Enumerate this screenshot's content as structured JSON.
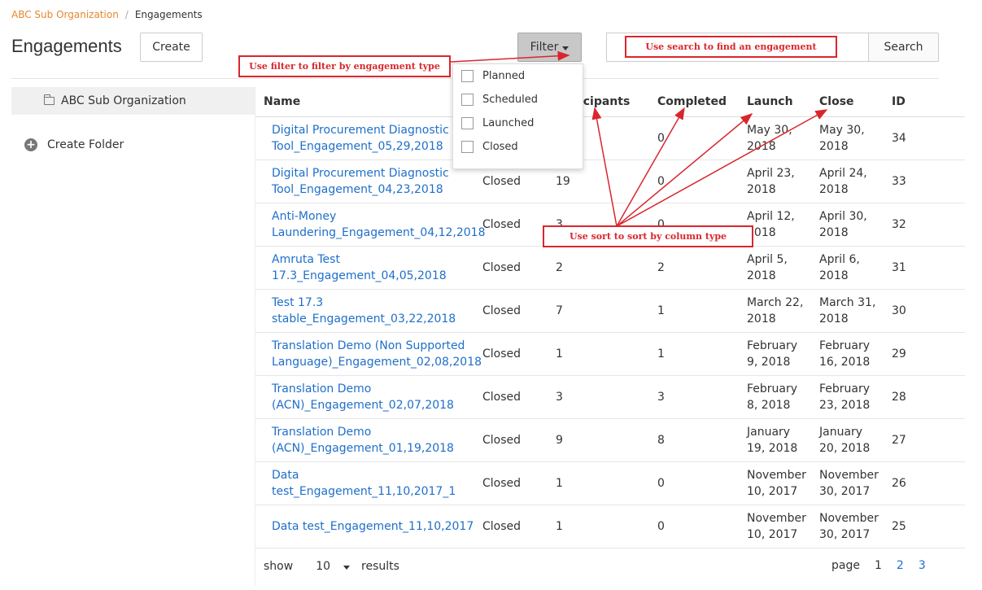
{
  "breadcrumb": {
    "org": "ABC Sub Organization",
    "separator": "/",
    "current": "Engagements"
  },
  "page_title": "Engagements",
  "toolbar": {
    "create_label": "Create",
    "filter_label": "Filter",
    "search_button": "Search",
    "search_value": ""
  },
  "filter_menu": {
    "options": [
      "Planned",
      "Scheduled",
      "Launched",
      "Closed"
    ]
  },
  "sidebar": {
    "folder": "ABC Sub Organization",
    "create_folder": "Create Folder"
  },
  "table": {
    "headers": {
      "name": "Name",
      "participants": "Participants",
      "completed": "Completed",
      "launch": "Launch",
      "close": "Close",
      "id": "ID"
    },
    "rows": [
      {
        "name": [
          "Digital Procurement Diagnostic",
          "Tool_Engagement_05,29,2018"
        ],
        "status": "",
        "participants": "",
        "completed": "0",
        "launch": [
          "May 30,",
          "2018"
        ],
        "close": [
          "May 30,",
          "2018"
        ],
        "id": "34"
      },
      {
        "name": [
          "Digital Procurement Diagnostic",
          "Tool_Engagement_04,23,2018"
        ],
        "status": "Closed",
        "participants": "19",
        "completed": "0",
        "launch": [
          "April 23,",
          "2018"
        ],
        "close": [
          "April 24,",
          "2018"
        ],
        "id": "33"
      },
      {
        "name": [
          "Anti-Money",
          "Laundering_Engagement_04,12,2018"
        ],
        "status": "Closed",
        "participants": "3",
        "completed": "0",
        "launch": [
          "April 12,",
          "2018"
        ],
        "close": [
          "April 30,",
          "2018"
        ],
        "id": "32"
      },
      {
        "name": [
          "Amruta Test",
          "17.3_Engagement_04,05,2018"
        ],
        "status": "Closed",
        "participants": "2",
        "completed": "2",
        "launch": [
          "April 5,",
          "2018"
        ],
        "close": [
          "April 6,",
          "2018"
        ],
        "id": "31"
      },
      {
        "name": [
          "Test 17.3",
          "stable_Engagement_03,22,2018"
        ],
        "status": "Closed",
        "participants": "7",
        "completed": "1",
        "launch": [
          "March 22,",
          "2018"
        ],
        "close": [
          "March 31,",
          "2018"
        ],
        "id": "30"
      },
      {
        "name": [
          "Translation Demo (Non Supported",
          "Language)_Engagement_02,08,2018"
        ],
        "status": "Closed",
        "participants": "1",
        "completed": "1",
        "launch": [
          "February",
          "9, 2018"
        ],
        "close": [
          "February",
          "16, 2018"
        ],
        "id": "29"
      },
      {
        "name": [
          "Translation Demo",
          "(ACN)_Engagement_02,07,2018"
        ],
        "status": "Closed",
        "participants": "3",
        "completed": "3",
        "launch": [
          "February",
          "8, 2018"
        ],
        "close": [
          "February",
          "23, 2018"
        ],
        "id": "28"
      },
      {
        "name": [
          "Translation Demo",
          "(ACN)_Engagement_01,19,2018"
        ],
        "status": "Closed",
        "participants": "9",
        "completed": "8",
        "launch": [
          "January",
          "19, 2018"
        ],
        "close": [
          "January",
          "20, 2018"
        ],
        "id": "27"
      },
      {
        "name": [
          "Data test_Engagement_11,10,2017_1",
          ""
        ],
        "status": "Closed",
        "participants": "1",
        "completed": "0",
        "launch": [
          "November",
          "10, 2017"
        ],
        "close": [
          "November",
          "30, 2017"
        ],
        "id": "26"
      },
      {
        "name": [
          "Data test_Engagement_11,10,2017",
          ""
        ],
        "status": "Closed",
        "participants": "1",
        "completed": "0",
        "launch": [
          "November",
          "10, 2017"
        ],
        "close": [
          "November",
          "30, 2017"
        ],
        "id": "25"
      }
    ]
  },
  "footer": {
    "show_label": "show",
    "page_size": "10",
    "results_label": "results",
    "page_label": "page",
    "pages": [
      "1",
      "2",
      "3"
    ],
    "current_page": "1"
  },
  "annotations": {
    "filter": "Use filter to filter by engagement type",
    "search": "Use search to find an engagement",
    "sort": "Use sort to sort by column type"
  },
  "colors": {
    "link": "#1f6fc9",
    "breadcrumb_link": "#e8872b",
    "annotation": "#d9262d"
  }
}
